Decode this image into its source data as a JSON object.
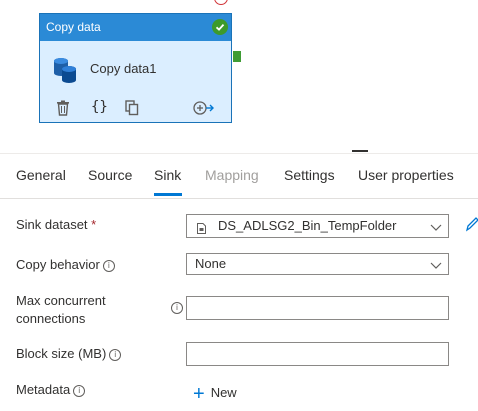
{
  "activity": {
    "header": "Copy data",
    "name": "Copy data1",
    "status_icon": "checkmark-circle-icon",
    "actions": [
      "delete-icon",
      "code-braces-icon",
      "copy-icon",
      "add-output-icon"
    ]
  },
  "tabs": [
    {
      "label": "General",
      "state": "normal"
    },
    {
      "label": "Source",
      "state": "normal"
    },
    {
      "label": "Sink",
      "state": "active"
    },
    {
      "label": "Mapping",
      "state": "disabled"
    },
    {
      "label": "Settings",
      "state": "normal"
    },
    {
      "label": "User properties",
      "state": "normal"
    }
  ],
  "form": {
    "sink_dataset": {
      "label": "Sink dataset",
      "required_mark": "*",
      "value": "DS_ADLSG2_Bin_TempFolder"
    },
    "copy_behavior": {
      "label": "Copy behavior",
      "value": "None"
    },
    "max_concurrent": {
      "label_line1": "Max concurrent",
      "label_line2": "connections",
      "value": ""
    },
    "block_size": {
      "label": "Block size (MB)",
      "value": ""
    },
    "metadata": {
      "label": "Metadata",
      "new_label": "New"
    }
  },
  "colors": {
    "accent": "#0078d4",
    "card_header": "#2b8ad6",
    "card_body": "#dbeeff",
    "success": "#3d9a2b",
    "required": "#a4262c"
  }
}
